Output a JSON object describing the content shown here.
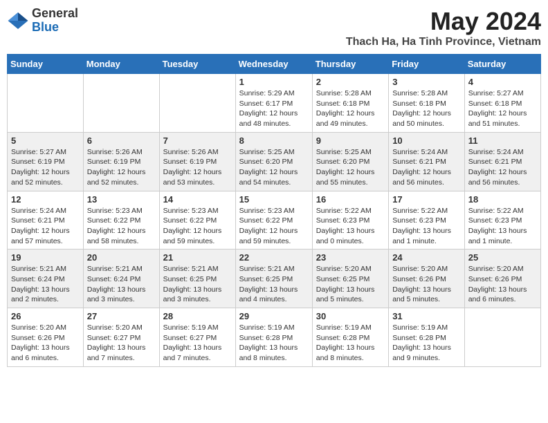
{
  "header": {
    "logo_general": "General",
    "logo_blue": "Blue",
    "title": "May 2024",
    "subtitle": "Thach Ha, Ha Tinh Province, Vietnam"
  },
  "days_of_week": [
    "Sunday",
    "Monday",
    "Tuesday",
    "Wednesday",
    "Thursday",
    "Friday",
    "Saturday"
  ],
  "weeks": [
    [
      {
        "day": "",
        "info": ""
      },
      {
        "day": "",
        "info": ""
      },
      {
        "day": "",
        "info": ""
      },
      {
        "day": "1",
        "info": "Sunrise: 5:29 AM\nSunset: 6:17 PM\nDaylight: 12 hours\nand 48 minutes."
      },
      {
        "day": "2",
        "info": "Sunrise: 5:28 AM\nSunset: 6:18 PM\nDaylight: 12 hours\nand 49 minutes."
      },
      {
        "day": "3",
        "info": "Sunrise: 5:28 AM\nSunset: 6:18 PM\nDaylight: 12 hours\nand 50 minutes."
      },
      {
        "day": "4",
        "info": "Sunrise: 5:27 AM\nSunset: 6:18 PM\nDaylight: 12 hours\nand 51 minutes."
      }
    ],
    [
      {
        "day": "5",
        "info": "Sunrise: 5:27 AM\nSunset: 6:19 PM\nDaylight: 12 hours\nand 52 minutes."
      },
      {
        "day": "6",
        "info": "Sunrise: 5:26 AM\nSunset: 6:19 PM\nDaylight: 12 hours\nand 52 minutes."
      },
      {
        "day": "7",
        "info": "Sunrise: 5:26 AM\nSunset: 6:19 PM\nDaylight: 12 hours\nand 53 minutes."
      },
      {
        "day": "8",
        "info": "Sunrise: 5:25 AM\nSunset: 6:20 PM\nDaylight: 12 hours\nand 54 minutes."
      },
      {
        "day": "9",
        "info": "Sunrise: 5:25 AM\nSunset: 6:20 PM\nDaylight: 12 hours\nand 55 minutes."
      },
      {
        "day": "10",
        "info": "Sunrise: 5:24 AM\nSunset: 6:21 PM\nDaylight: 12 hours\nand 56 minutes."
      },
      {
        "day": "11",
        "info": "Sunrise: 5:24 AM\nSunset: 6:21 PM\nDaylight: 12 hours\nand 56 minutes."
      }
    ],
    [
      {
        "day": "12",
        "info": "Sunrise: 5:24 AM\nSunset: 6:21 PM\nDaylight: 12 hours\nand 57 minutes."
      },
      {
        "day": "13",
        "info": "Sunrise: 5:23 AM\nSunset: 6:22 PM\nDaylight: 12 hours\nand 58 minutes."
      },
      {
        "day": "14",
        "info": "Sunrise: 5:23 AM\nSunset: 6:22 PM\nDaylight: 12 hours\nand 59 minutes."
      },
      {
        "day": "15",
        "info": "Sunrise: 5:23 AM\nSunset: 6:22 PM\nDaylight: 12 hours\nand 59 minutes."
      },
      {
        "day": "16",
        "info": "Sunrise: 5:22 AM\nSunset: 6:23 PM\nDaylight: 13 hours\nand 0 minutes."
      },
      {
        "day": "17",
        "info": "Sunrise: 5:22 AM\nSunset: 6:23 PM\nDaylight: 13 hours\nand 1 minute."
      },
      {
        "day": "18",
        "info": "Sunrise: 5:22 AM\nSunset: 6:23 PM\nDaylight: 13 hours\nand 1 minute."
      }
    ],
    [
      {
        "day": "19",
        "info": "Sunrise: 5:21 AM\nSunset: 6:24 PM\nDaylight: 13 hours\nand 2 minutes."
      },
      {
        "day": "20",
        "info": "Sunrise: 5:21 AM\nSunset: 6:24 PM\nDaylight: 13 hours\nand 3 minutes."
      },
      {
        "day": "21",
        "info": "Sunrise: 5:21 AM\nSunset: 6:25 PM\nDaylight: 13 hours\nand 3 minutes."
      },
      {
        "day": "22",
        "info": "Sunrise: 5:21 AM\nSunset: 6:25 PM\nDaylight: 13 hours\nand 4 minutes."
      },
      {
        "day": "23",
        "info": "Sunrise: 5:20 AM\nSunset: 6:25 PM\nDaylight: 13 hours\nand 5 minutes."
      },
      {
        "day": "24",
        "info": "Sunrise: 5:20 AM\nSunset: 6:26 PM\nDaylight: 13 hours\nand 5 minutes."
      },
      {
        "day": "25",
        "info": "Sunrise: 5:20 AM\nSunset: 6:26 PM\nDaylight: 13 hours\nand 6 minutes."
      }
    ],
    [
      {
        "day": "26",
        "info": "Sunrise: 5:20 AM\nSunset: 6:26 PM\nDaylight: 13 hours\nand 6 minutes."
      },
      {
        "day": "27",
        "info": "Sunrise: 5:20 AM\nSunset: 6:27 PM\nDaylight: 13 hours\nand 7 minutes."
      },
      {
        "day": "28",
        "info": "Sunrise: 5:19 AM\nSunset: 6:27 PM\nDaylight: 13 hours\nand 7 minutes."
      },
      {
        "day": "29",
        "info": "Sunrise: 5:19 AM\nSunset: 6:28 PM\nDaylight: 13 hours\nand 8 minutes."
      },
      {
        "day": "30",
        "info": "Sunrise: 5:19 AM\nSunset: 6:28 PM\nDaylight: 13 hours\nand 8 minutes."
      },
      {
        "day": "31",
        "info": "Sunrise: 5:19 AM\nSunset: 6:28 PM\nDaylight: 13 hours\nand 9 minutes."
      },
      {
        "day": "",
        "info": ""
      }
    ]
  ]
}
